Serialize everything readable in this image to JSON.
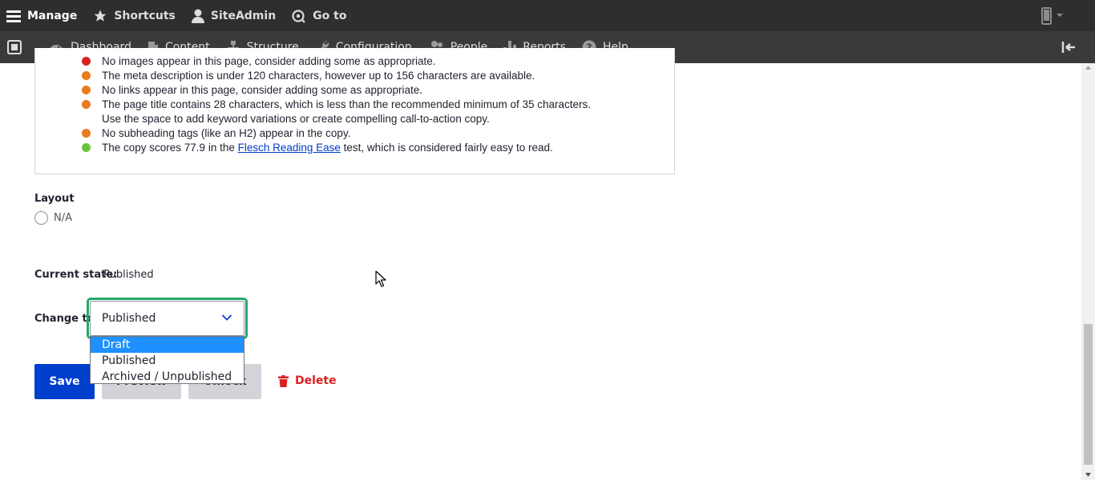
{
  "toolbar": {
    "manage_label": "Manage",
    "shortcuts_label": "Shortcuts",
    "user_label": "SiteAdmin",
    "goto_label": "Go to"
  },
  "tray": {
    "items": [
      {
        "label": "Dashboard",
        "icon": "dashboard-icon"
      },
      {
        "label": "Content",
        "icon": "content-icon"
      },
      {
        "label": "Structure",
        "icon": "structure-icon"
      },
      {
        "label": "Configuration",
        "icon": "wrench-icon"
      },
      {
        "label": "People",
        "icon": "people-icon"
      },
      {
        "label": "Reports",
        "icon": "reports-icon"
      },
      {
        "label": "Help",
        "icon": "help-icon"
      }
    ]
  },
  "seo": {
    "items": [
      {
        "status": "red",
        "text": "No images appear in this page, consider adding some as appropriate."
      },
      {
        "status": "orange",
        "text": "The meta description is under 120 characters, however up to 156 characters are available."
      },
      {
        "status": "orange",
        "text": "No links appear in this page, consider adding some as appropriate."
      },
      {
        "status": "orange",
        "text": "The page title contains 28 characters, which is less than the recommended minimum of 35 characters. Use the space to add keyword variations or create compelling call-to-action copy."
      },
      {
        "status": "orange",
        "text": "No subheading tags (like an H2) appear in the copy."
      },
      {
        "status": "green",
        "text_before": "The copy scores 77.9 in the ",
        "link_text": "Flesch Reading Ease",
        "text_after": " test, which is considered fairly easy to read."
      }
    ]
  },
  "status_colors": {
    "red": "#d72222",
    "orange": "#e87b1c",
    "green": "#6bc33d"
  },
  "layout_field": {
    "label": "Layout",
    "option": "N/A"
  },
  "moderation": {
    "current_state_label": "Current state:",
    "current_state_value": "Published",
    "change_to_label": "Change to:",
    "selected": "Published",
    "options": [
      "Draft",
      "Published",
      "Archived / Unpublished"
    ],
    "highlighted_option": "Draft"
  },
  "actions": {
    "save_label": "Save",
    "preview_label": "Preview",
    "unlock_label": "Unlock",
    "delete_label": "Delete"
  },
  "colors": {
    "primary": "#003ecc",
    "focus_ring": "#26a769",
    "danger": "#d72222",
    "toolbar_bg": "#2e2e2e",
    "tray_bg": "#3a3a3a"
  }
}
